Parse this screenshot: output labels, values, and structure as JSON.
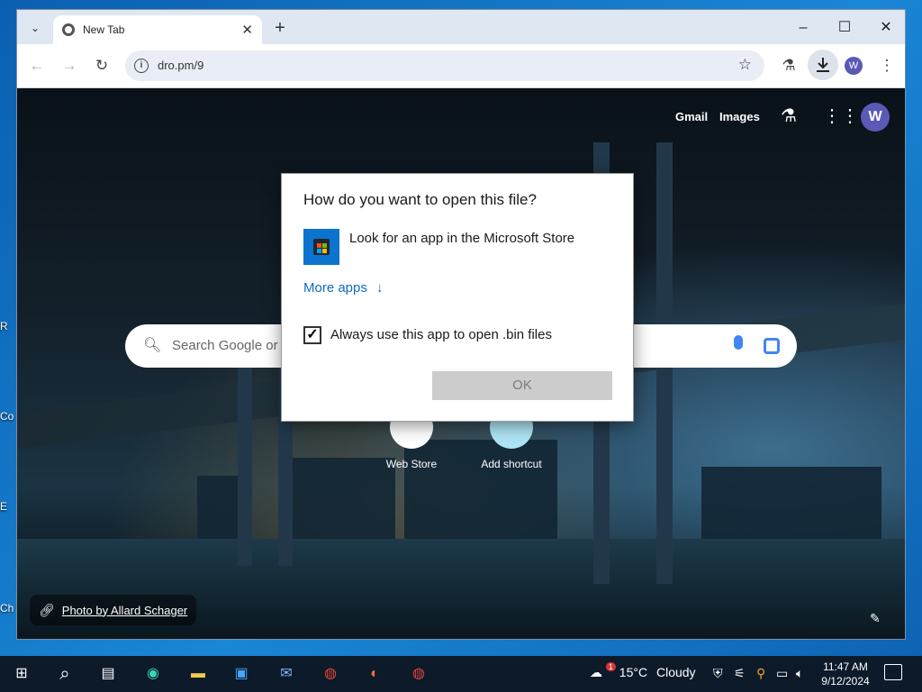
{
  "desktop": {
    "side_labels": [
      "R",
      "Co",
      "E",
      "Ch"
    ]
  },
  "browser": {
    "tab_title": "New Tab",
    "url": "dro.pm/9",
    "window_controls": {
      "minimize": "–",
      "maximize": "☐",
      "close": "✕"
    },
    "profile_initial": "W"
  },
  "ntp": {
    "gmail": "Gmail",
    "images": "Images",
    "profile_initial": "W",
    "search_placeholder": "Search Google or",
    "shortcuts": [
      {
        "label": "Web Store"
      },
      {
        "label": "Add shortcut"
      }
    ],
    "photo_credit": "Photo by Allard Schager"
  },
  "dialog": {
    "title": "How do you want to open this file?",
    "store_option": "Look for an app in the Microsoft Store",
    "more_apps": "More apps",
    "more_apps_arrow": "↓",
    "always_use_label": "Always use this app to open .bin files",
    "always_use_checked": true,
    "ok_label": "OK"
  },
  "taskbar": {
    "weather_temp": "15°C",
    "weather_desc": "Cloudy",
    "weather_badge": "1",
    "time": "11:47 AM",
    "date": "9/12/2024"
  },
  "colors": {
    "accent_link": "#0e6cc4",
    "profile_purple": "#5a59b6",
    "store_blue": "#0c73cf"
  }
}
